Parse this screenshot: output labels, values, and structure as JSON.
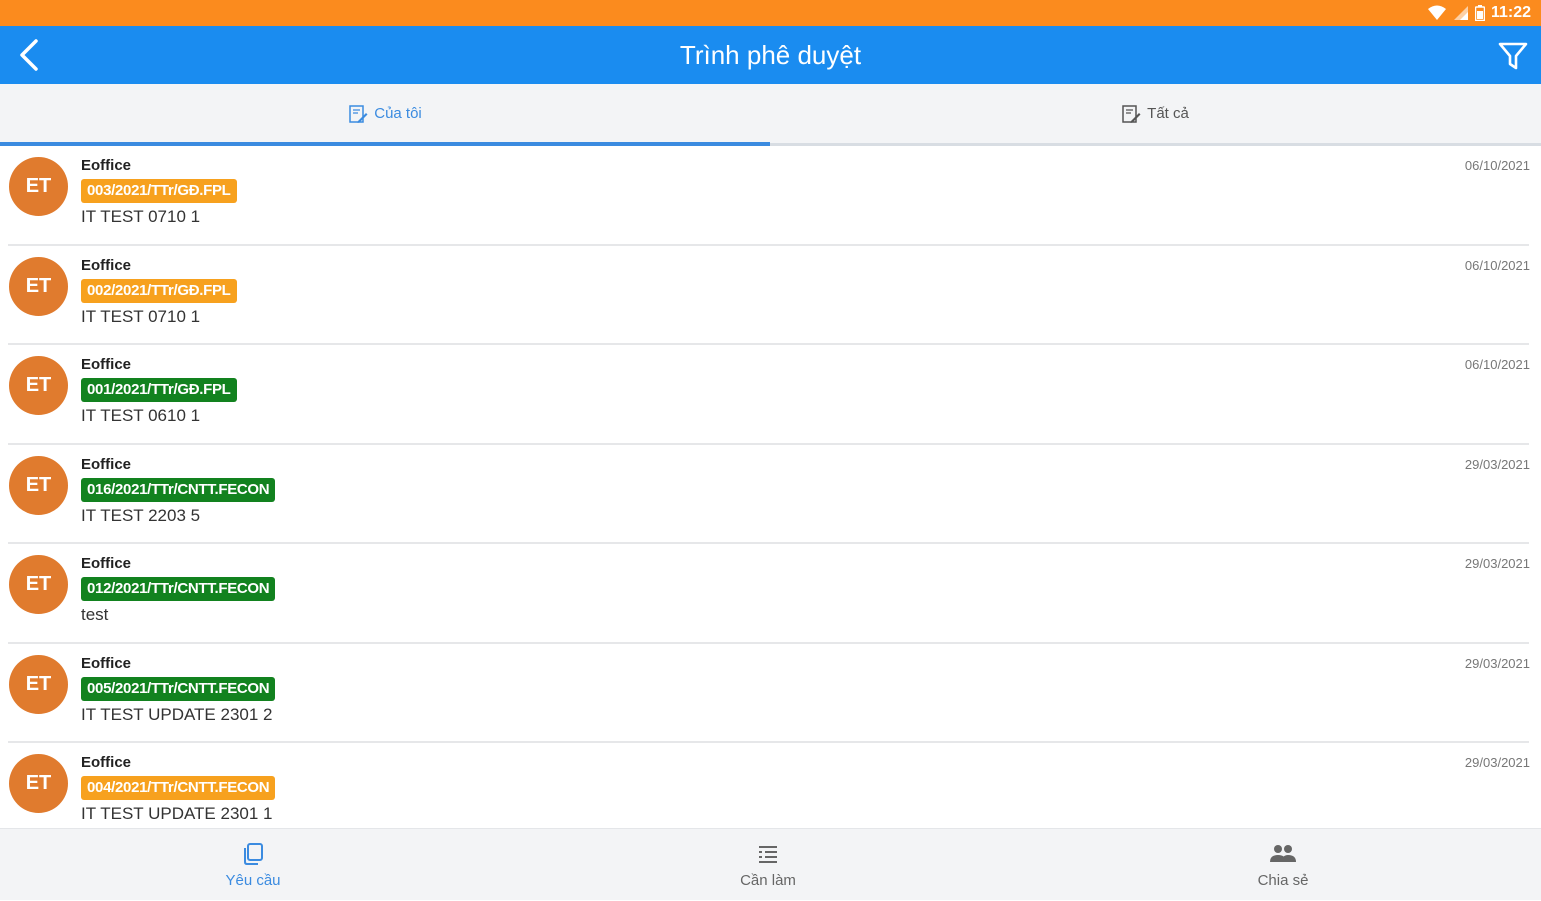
{
  "status_bar": {
    "time": "11:22",
    "icons": [
      "wifi-icon",
      "signal-icon",
      "battery-icon"
    ]
  },
  "app_bar": {
    "title": "Trình phê duyệt",
    "back_icon": "back-arrow-icon",
    "filter_icon": "filter-icon"
  },
  "tabs": [
    {
      "label": "Của tôi",
      "icon": "document-edit-icon",
      "active": true
    },
    {
      "label": "Tất cả",
      "icon": "document-edit-icon",
      "active": false
    }
  ],
  "items": [
    {
      "avatar": "ET",
      "sender": "Eoffice",
      "code": "003/2021/TTr/GĐ.FPL",
      "code_status": "pending",
      "subject": "IT TEST 0710 1",
      "date": "06/10/2021"
    },
    {
      "avatar": "ET",
      "sender": "Eoffice",
      "code": "002/2021/TTr/GĐ.FPL",
      "code_status": "pending",
      "subject": "IT TEST 0710 1",
      "date": "06/10/2021"
    },
    {
      "avatar": "ET",
      "sender": "Eoffice",
      "code": "001/2021/TTr/GĐ.FPL",
      "code_status": "approved",
      "subject": "IT TEST 0610 1",
      "date": "06/10/2021"
    },
    {
      "avatar": "ET",
      "sender": "Eoffice",
      "code": "016/2021/TTr/CNTT.FECON",
      "code_status": "approved",
      "subject": "IT TEST 2203 5",
      "date": "29/03/2021"
    },
    {
      "avatar": "ET",
      "sender": "Eoffice",
      "code": "012/2021/TTr/CNTT.FECON",
      "code_status": "approved",
      "subject": "test",
      "date": "29/03/2021"
    },
    {
      "avatar": "ET",
      "sender": "Eoffice",
      "code": "005/2021/TTr/CNTT.FECON",
      "code_status": "approved",
      "subject": "IT TEST UPDATE 2301 2",
      "date": "29/03/2021"
    },
    {
      "avatar": "ET",
      "sender": "Eoffice",
      "code": "004/2021/TTr/CNTT.FECON",
      "code_status": "pending",
      "subject": "IT TEST UPDATE 2301 1",
      "date": "29/03/2021"
    }
  ],
  "bottom_nav": [
    {
      "label": "Yêu cầu",
      "icon": "copy-icon",
      "active": true
    },
    {
      "label": "Cần làm",
      "icon": "list-icon",
      "active": false
    },
    {
      "label": "Chia sẻ",
      "icon": "people-icon",
      "active": false
    }
  ],
  "colors": {
    "status_bar": "#fb8b1e",
    "app_bar": "#1a8cf0",
    "accent": "#3b8be0",
    "avatar": "#e07b2e",
    "pending": "#f7a11e",
    "approved": "#12821f"
  }
}
